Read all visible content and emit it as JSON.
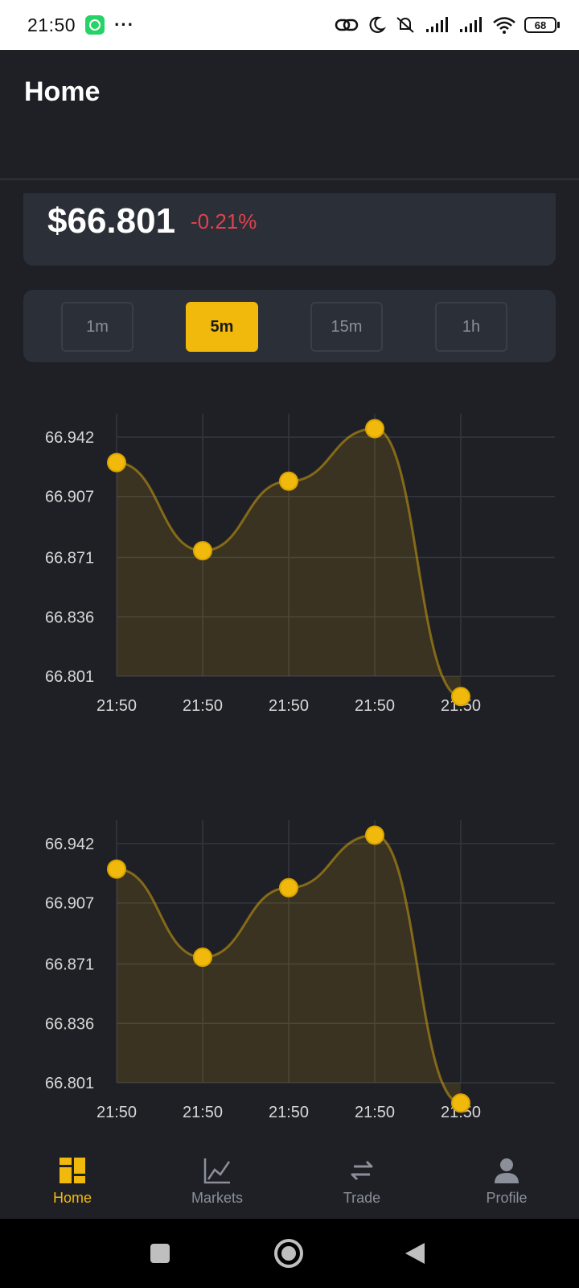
{
  "status_bar": {
    "time": "21:50",
    "dots": "···",
    "battery": "68"
  },
  "header": {
    "title": "Home"
  },
  "price": {
    "value": "$66.801",
    "change": "-0.21%"
  },
  "timeframes": [
    {
      "label": "1m",
      "active": false
    },
    {
      "label": "5m",
      "active": true
    },
    {
      "label": "15m",
      "active": false
    },
    {
      "label": "1h",
      "active": false
    }
  ],
  "colors": {
    "accent": "#f0b90b",
    "negative": "#e0414f",
    "background": "#1f2026",
    "card": "#2b2f37"
  },
  "chart_data": [
    {
      "type": "area",
      "categories": [
        "21:50",
        "21:50",
        "21:50",
        "21:50",
        "21:50"
      ],
      "values": [
        66.927,
        66.875,
        66.916,
        66.947,
        66.789
      ],
      "y_ticks": [
        "66.942",
        "66.907",
        "66.871",
        "66.836",
        "66.801"
      ],
      "ylim": [
        66.801,
        66.942
      ],
      "grid": true
    },
    {
      "type": "area",
      "categories": [
        "21:50",
        "21:50",
        "21:50",
        "21:50",
        "21:50"
      ],
      "values": [
        66.927,
        66.875,
        66.916,
        66.947,
        66.789
      ],
      "y_ticks": [
        "66.942",
        "66.907",
        "66.871",
        "66.836",
        "66.801"
      ],
      "ylim": [
        66.801,
        66.942
      ],
      "grid": true
    }
  ],
  "bottom_nav": [
    {
      "label": "Home",
      "icon": "dashboard-icon",
      "active": true
    },
    {
      "label": "Markets",
      "icon": "line-chart-icon",
      "active": false
    },
    {
      "label": "Trade",
      "icon": "swap-arrows-icon",
      "active": false
    },
    {
      "label": "Profile",
      "icon": "user-icon",
      "active": false
    }
  ],
  "system_nav": [
    "recents-square-icon",
    "home-circle-icon",
    "back-triangle-icon"
  ]
}
